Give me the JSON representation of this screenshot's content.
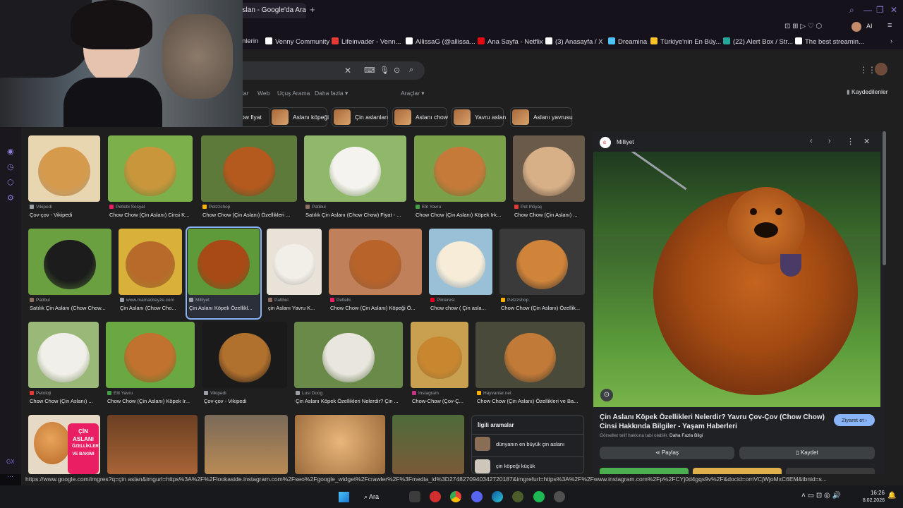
{
  "browser": {
    "active_tab": "aslan - Google'da Ara",
    "bookmarks": [
      {
        "label": "nlerin",
        "color": "#000000"
      },
      {
        "label": "Venny Community",
        "color": "#ffffff"
      },
      {
        "label": "Lifeinvader - Venn...",
        "color": "#e53935"
      },
      {
        "label": "AllissaG (@allissa...",
        "color": "#ffffff"
      },
      {
        "label": "Ana Sayfa - Netflix",
        "color": "#e50914"
      },
      {
        "label": "(3) Anasayfa / X",
        "color": "#ffffff"
      },
      {
        "label": "Dreamina",
        "color": "#4fc3f7"
      },
      {
        "label": "Türkiye'nin En Büy...",
        "color": "#fbc02d"
      },
      {
        "label": "(22) Alert Box / Str...",
        "color": "#26a69a"
      },
      {
        "label": "The best streamin...",
        "color": "#ffffff"
      }
    ],
    "top_right_label": "AI"
  },
  "search": {
    "nav_links": [
      "lar",
      "Web",
      "Uçuş Arama",
      "Daha fazla ▾"
    ],
    "tools_label": "Araçlar ▾",
    "saved_label": "Kaydedilenler",
    "chips": [
      "ow fiyat",
      "Aslanı köpeği",
      "Çin aslanları",
      "Aslanı chow",
      "Yavru aslan",
      "Aslanı yavrusu"
    ]
  },
  "results": [
    {
      "source": "Vikipedi",
      "title": "Çov-çov - Vikipedi",
      "src_color": "#9aa0a6"
    },
    {
      "source": "Petlebi Sosyal",
      "title": "Chow Chow (Çin Aslanı) Cinsi K...",
      "src_color": "#e91e63"
    },
    {
      "source": "Petzzshop",
      "title": "Chow Chow (Çin Aslanı) Özellikleri ...",
      "src_color": "#ffb300"
    },
    {
      "source": "Patibul",
      "title": "Satılık Çin Aslanı (Chow Chow) Fiyat - ...",
      "src_color": "#8d6e63"
    },
    {
      "source": "Elit Yavru",
      "title": "Chow Chow (Çin Aslanı) Köpek Irk...",
      "src_color": "#43a047"
    },
    {
      "source": "Pet İhtiyaç",
      "title": "Chow Chow (Çin Aslanı) ...",
      "src_color": "#e53935"
    },
    {
      "source": "Patibul",
      "title": "Satılık Çin Aslanı (Chow Chow...",
      "src_color": "#8d6e63"
    },
    {
      "source": "www.mamaciteyze.com",
      "title": "Çin Aslanı (Chow Cho...",
      "src_color": "#9aa0a6"
    },
    {
      "source": "Milliyet",
      "title": "Çin Aslanı Köpek Özellikl...",
      "src_color": "#9aa0a6"
    },
    {
      "source": "Patibul",
      "title": "çin Aslanı Yavru K...",
      "src_color": "#8d6e63"
    },
    {
      "source": "Petlebi",
      "title": "Chow Chow (Çin Aslanı) Köpeği Ö...",
      "src_color": "#e91e63"
    },
    {
      "source": "Pinterest",
      "title": "Chow chow ( Çin asla...",
      "src_color": "#e60023"
    },
    {
      "source": "Petzzshop",
      "title": "Chow Chow (Çin Aslanı) Özellik...",
      "src_color": "#ffb300"
    },
    {
      "source": "Petoloji",
      "title": "Chow Chow (Çin Aslanı) ...",
      "src_color": "#e53935"
    },
    {
      "source": "Elit Yavru",
      "title": "Chow Chow (Çin Aslanı) Köpek Ir...",
      "src_color": "#43a047"
    },
    {
      "source": "Vikipedi",
      "title": "Çov-çov - Vikipedi",
      "src_color": "#9aa0a6"
    },
    {
      "source": "Lusi Doog",
      "title": "Çin Aslanı Köpek Özellikleri Nelerdir? Çin ...",
      "src_color": "#9aa0a6"
    },
    {
      "source": "Instagram",
      "title": "Chow-Chow (Çov-Ç...",
      "src_color": "#c13584"
    },
    {
      "source": "Hayvanlar.net",
      "title": "Chow Chow (Çin Aslanı) Özellikleri ve Ba...",
      "src_color": "#ffb300"
    }
  ],
  "related": {
    "heading": "İlgili aramalar",
    "items": [
      "dünyanın en büyük çin aslanı",
      "çin köpeği küçük"
    ]
  },
  "preview": {
    "source": "Milliyet",
    "title": "Çin Aslanı Köpek Özellikleri Nelerdir? Yavru Çov-Çov (Chow Chow) Cinsi Hakkında Bilgiler - Yaşam Haberleri",
    "note_prefix": "Görseller telif hakkına tabi olabilir. ",
    "note_link": "Daha Fazla Bilgi",
    "visit_label": "Ziyaret et",
    "share_label": "Paylaş",
    "save_label": "Kaydet"
  },
  "status_url": "https://www.google.com/imgres?q=çin aslan&imgurl=https%3A%2F%2Flookaside.instagram.com%2Fseo%2Fgoogle_widget%2Fcrawler%2F%3Fmedia_id%3D2748270940342720187&imgrefurl=https%3A%2F%2Fwww.instagram.com%2Fp%2FCYj0d4gqs9v%2F&docid=omVCjWjoMxC6EM&tbnid=s...",
  "promo_overlay": [
    "ÇİN",
    "ASLANI",
    "ÖZELLİKLERİ",
    "VE BAKIMI"
  ],
  "taskbar": {
    "search_label": "Ara",
    "time": "16:26",
    "date": "8.02.2026"
  },
  "rail_label": "GX"
}
